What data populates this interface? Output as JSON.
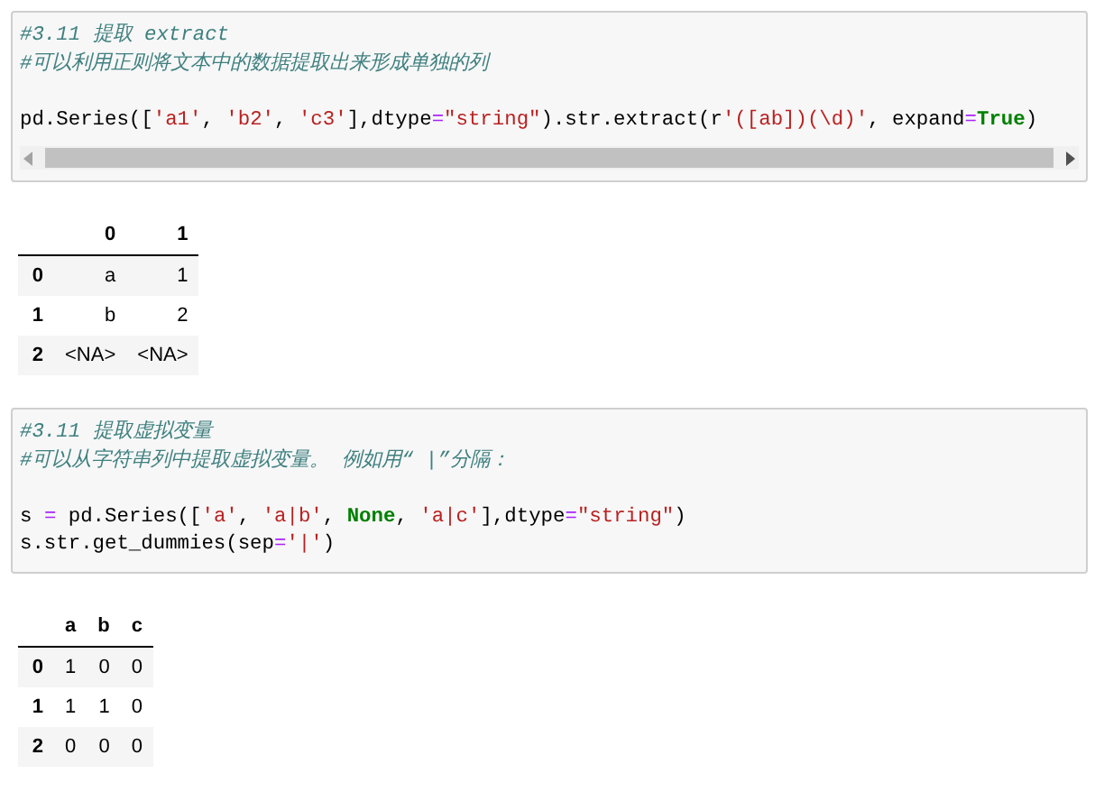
{
  "cells": [
    {
      "code_blocks": [
        {
          "lines": [
            {
              "tokens": [
                {
                  "kind": "comment",
                  "text": "#3.11 提取 extract"
                }
              ]
            },
            {
              "tokens": [
                {
                  "kind": "comment",
                  "text": "#可以利用正则将文本中的数据提取出来形成单独的列"
                }
              ]
            }
          ]
        },
        {
          "lines": [
            {
              "tokens": [
                {
                  "kind": "plain",
                  "text": "pd.Series(["
                },
                {
                  "kind": "string",
                  "text": "'a1'"
                },
                {
                  "kind": "plain",
                  "text": ", "
                },
                {
                  "kind": "string",
                  "text": "'b2'"
                },
                {
                  "kind": "plain",
                  "text": ", "
                },
                {
                  "kind": "string",
                  "text": "'c3'"
                },
                {
                  "kind": "plain",
                  "text": "],dtype"
                },
                {
                  "kind": "op",
                  "text": "="
                },
                {
                  "kind": "string",
                  "text": "\"string\""
                },
                {
                  "kind": "plain",
                  "text": ").str.extract(r"
                },
                {
                  "kind": "string",
                  "text": "'([ab])(\\d)'"
                },
                {
                  "kind": "plain",
                  "text": ", expand"
                },
                {
                  "kind": "op",
                  "text": "="
                },
                {
                  "kind": "keyword",
                  "text": "True"
                },
                {
                  "kind": "plain",
                  "text": ")"
                }
              ]
            }
          ]
        }
      ],
      "scrollbar": true,
      "output": {
        "columns": [
          "0",
          "1"
        ],
        "rows": [
          {
            "index": "0",
            "values": [
              "a",
              "1"
            ]
          },
          {
            "index": "1",
            "values": [
              "b",
              "2"
            ]
          },
          {
            "index": "2",
            "values": [
              "<NA>",
              "<NA>"
            ]
          }
        ]
      }
    },
    {
      "code_blocks": [
        {
          "lines": [
            {
              "tokens": [
                {
                  "kind": "comment",
                  "text": "#3.11 提取虚拟变量"
                }
              ]
            },
            {
              "tokens": [
                {
                  "kind": "comment",
                  "text": "#可以从字符串列中提取虚拟变量。 例如用“ |”分隔："
                }
              ]
            }
          ]
        },
        {
          "lines": [
            {
              "tokens": [
                {
                  "kind": "plain",
                  "text": "s "
                },
                {
                  "kind": "op",
                  "text": "="
                },
                {
                  "kind": "plain",
                  "text": " pd.Series(["
                },
                {
                  "kind": "string",
                  "text": "'a'"
                },
                {
                  "kind": "plain",
                  "text": ", "
                },
                {
                  "kind": "string",
                  "text": "'a|b'"
                },
                {
                  "kind": "plain",
                  "text": ", "
                },
                {
                  "kind": "keyword",
                  "text": "None"
                },
                {
                  "kind": "plain",
                  "text": ", "
                },
                {
                  "kind": "string",
                  "text": "'a|c'"
                },
                {
                  "kind": "plain",
                  "text": "],dtype"
                },
                {
                  "kind": "op",
                  "text": "="
                },
                {
                  "kind": "string",
                  "text": "\"string\""
                },
                {
                  "kind": "plain",
                  "text": ")"
                }
              ]
            },
            {
              "tokens": [
                {
                  "kind": "plain",
                  "text": "s.str.get_dummies(sep"
                },
                {
                  "kind": "op",
                  "text": "="
                },
                {
                  "kind": "string",
                  "text": "'|'"
                },
                {
                  "kind": "plain",
                  "text": ")"
                }
              ]
            }
          ]
        }
      ],
      "scrollbar": false,
      "output": {
        "columns": [
          "a",
          "b",
          "c"
        ],
        "rows": [
          {
            "index": "0",
            "values": [
              "1",
              "0",
              "0"
            ]
          },
          {
            "index": "1",
            "values": [
              "1",
              "1",
              "0"
            ]
          },
          {
            "index": "2",
            "values": [
              "0",
              "0",
              "0"
            ]
          }
        ]
      }
    }
  ]
}
